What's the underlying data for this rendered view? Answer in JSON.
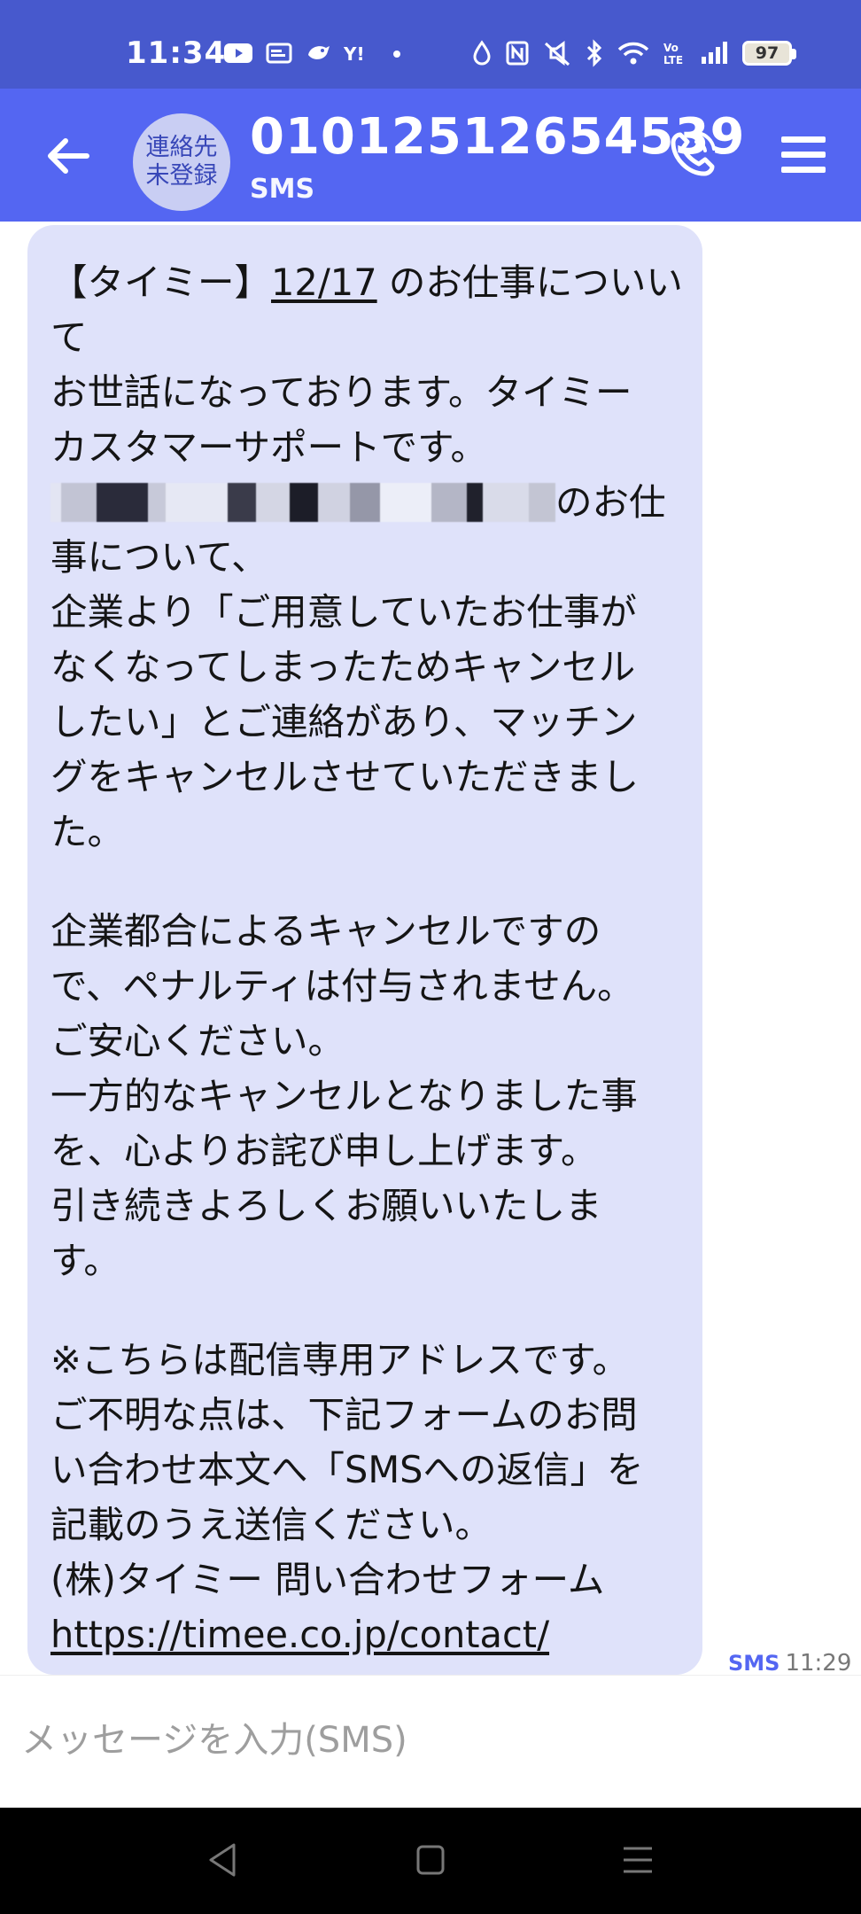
{
  "status_bar": {
    "time": "11:34",
    "battery": "97"
  },
  "app_bar": {
    "avatar_line1": "連絡先",
    "avatar_line2": "未登録",
    "title": "01012512654539",
    "subtitle": "SMS"
  },
  "message": {
    "lines": [
      {
        "pre": "【タイミー】",
        "u": "12/17",
        "post": " のお仕事についい"
      },
      "て",
      "お世話になっております。タイミー",
      "カスタマーサポートです。",
      {
        "redacted": true,
        "post": "のお仕"
      },
      "事について、",
      "企業より「ご用意していたお仕事が",
      "なくなってしまったためキャンセル",
      "したい」とご連絡があり、マッチン",
      "グをキャンセルさせていただきまし",
      "た。",
      "",
      "企業都合によるキャンセルですの",
      "で、ペナルティは付与されません。",
      "ご安心ください。",
      "一方的なキャンセルとなりました事",
      "を、心よりお詫び申し上げます。",
      "引き続きよろしくお願いいたしま",
      "す。",
      "",
      "※こちらは配信専用アドレスです。",
      "ご不明な点は、下記フォームのお問",
      "い合わせ本文へ「SMSへの返信」を",
      "記載のうえ送信ください。",
      "(株)タイミー 問い合わせフォーム",
      {
        "link": "https://timee.co.jp/contact/"
      }
    ],
    "meta_type": "SMS",
    "meta_time": "11:29"
  },
  "input": {
    "placeholder": "メッセージを入力(SMS)"
  },
  "icons": {
    "back": "arrow-left-icon",
    "call": "phone-icon",
    "menu": "hamburger-menu-icon",
    "nav_back": "triangle-back-icon",
    "nav_home": "square-home-icon",
    "nav_recents": "lines-recents-icon"
  },
  "colors": {
    "status_bar": "#4759cd",
    "app_bar": "#5466f2",
    "bubble": "#dfe2fa",
    "avatar": "#c9cef3"
  }
}
